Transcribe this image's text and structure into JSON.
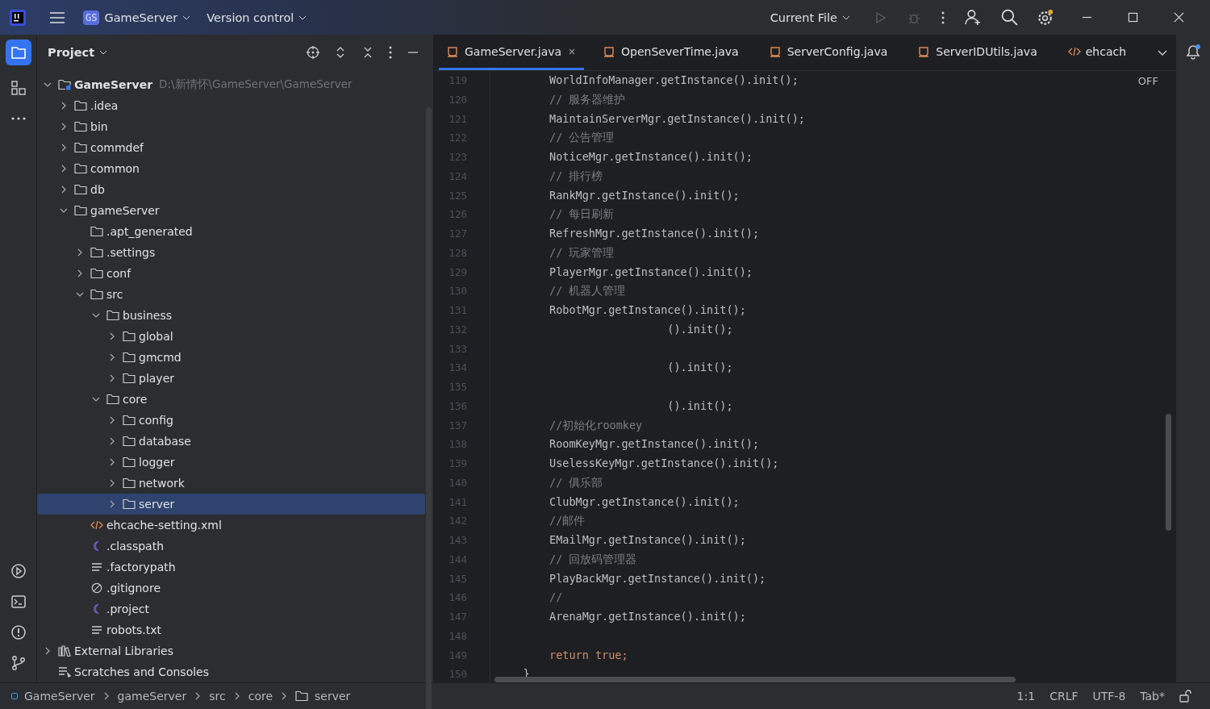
{
  "title_bar": {
    "project_badge": "GS",
    "project": "GameServer",
    "vcs": "Version control",
    "run_config": "Current File"
  },
  "project_panel": {
    "title": "Project",
    "tree": [
      {
        "label": "GameServer",
        "path": "D:\\新情怀\\GameServer\\GameServer",
        "kind": "module",
        "expanded": true,
        "selected": false,
        "children": [
          {
            "label": ".idea",
            "kind": "folder",
            "expanded": false,
            "selected": false
          },
          {
            "label": "bin",
            "kind": "folder",
            "expanded": false,
            "selected": false
          },
          {
            "label": "commdef",
            "kind": "folder",
            "expanded": false,
            "selected": false
          },
          {
            "label": "common",
            "kind": "folder",
            "expanded": false,
            "selected": false
          },
          {
            "label": "db",
            "kind": "folder",
            "expanded": false,
            "selected": false
          },
          {
            "label": "gameServer",
            "kind": "folder",
            "expanded": true,
            "selected": false,
            "children": [
              {
                "label": ".apt_generated",
                "kind": "folder",
                "selected": false
              },
              {
                "label": ".settings",
                "kind": "folder",
                "expanded": false,
                "selected": false
              },
              {
                "label": "conf",
                "kind": "folder",
                "expanded": false,
                "selected": false
              },
              {
                "label": "src",
                "kind": "folder",
                "expanded": true,
                "selected": false,
                "children": [
                  {
                    "label": "business",
                    "kind": "folder",
                    "expanded": true,
                    "selected": false,
                    "children": [
                      {
                        "label": "global",
                        "kind": "folder",
                        "expanded": false,
                        "selected": false
                      },
                      {
                        "label": "gmcmd",
                        "kind": "folder",
                        "expanded": false,
                        "selected": false
                      },
                      {
                        "label": "player",
                        "kind": "folder",
                        "expanded": false,
                        "selected": false
                      }
                    ]
                  },
                  {
                    "label": "core",
                    "kind": "folder",
                    "expanded": true,
                    "selected": false,
                    "children": [
                      {
                        "label": "config",
                        "kind": "folder",
                        "expanded": false,
                        "selected": false
                      },
                      {
                        "label": "database",
                        "kind": "folder",
                        "expanded": false,
                        "selected": false
                      },
                      {
                        "label": "logger",
                        "kind": "folder",
                        "expanded": false,
                        "selected": false
                      },
                      {
                        "label": "network",
                        "kind": "folder",
                        "expanded": false,
                        "selected": false
                      },
                      {
                        "label": "server",
                        "kind": "folder",
                        "expanded": false,
                        "selected": true
                      }
                    ]
                  }
                ]
              },
              {
                "label": "ehcache-setting.xml",
                "kind": "xml",
                "selected": false
              },
              {
                "label": ".classpath",
                "kind": "eclipse",
                "selected": false
              },
              {
                "label": ".factorypath",
                "kind": "text",
                "selected": false
              },
              {
                "label": ".gitignore",
                "kind": "ignore",
                "selected": false
              },
              {
                "label": ".project",
                "kind": "eclipse",
                "selected": false
              },
              {
                "label": "robots.txt",
                "kind": "text",
                "selected": false
              }
            ]
          }
        ]
      },
      {
        "label": "External Libraries",
        "kind": "libraries",
        "expanded": false,
        "selected": false
      },
      {
        "label": "Scratches and Consoles",
        "kind": "scratches",
        "selected": false
      }
    ]
  },
  "editor": {
    "tabs": [
      {
        "label": "GameServer.java",
        "kind": "java",
        "selected": true
      },
      {
        "label": "OpenSeverTime.java",
        "kind": "java",
        "selected": false
      },
      {
        "label": "ServerConfig.java",
        "kind": "java",
        "selected": false
      },
      {
        "label": "ServerIDUtils.java",
        "kind": "java",
        "selected": false
      },
      {
        "label": "ehcach",
        "kind": "xml",
        "selected": false
      }
    ],
    "inlay_status": "OFF",
    "lines": [
      {
        "number": "119",
        "kind": "code",
        "text": "        WorldInfoManager.getInstance().init();"
      },
      {
        "number": "120",
        "kind": "comment",
        "text": "        // 服务器维护"
      },
      {
        "number": "121",
        "kind": "code",
        "text": "        MaintainServerMgr.getInstance().init();"
      },
      {
        "number": "122",
        "kind": "comment",
        "text": "        // 公告管理"
      },
      {
        "number": "123",
        "kind": "code",
        "text": "        NoticeMgr.getInstance().init();"
      },
      {
        "number": "124",
        "kind": "comment",
        "text": "        // 排行榜"
      },
      {
        "number": "125",
        "kind": "code",
        "text": "        RankMgr.getInstance().init();"
      },
      {
        "number": "126",
        "kind": "comment",
        "text": "        // 每日刷新"
      },
      {
        "number": "127",
        "kind": "code",
        "text": "        RefreshMgr.getInstance().init();"
      },
      {
        "number": "128",
        "kind": "comment",
        "text": "        // 玩家管理"
      },
      {
        "number": "129",
        "kind": "code",
        "text": "        PlayerMgr.getInstance().init();"
      },
      {
        "number": "130",
        "kind": "comment",
        "text": "        // 机器人管理"
      },
      {
        "number": "131",
        "kind": "code",
        "text": "        RobotMgr.getInstance().init();"
      },
      {
        "number": "132",
        "kind": "code",
        "text": "                          ().init();"
      },
      {
        "number": "133"
      },
      {
        "number": "134",
        "kind": "code",
        "text": "                          ().init();"
      },
      {
        "number": "135"
      },
      {
        "number": "136",
        "kind": "code",
        "text": "                          ().init();"
      },
      {
        "number": "137",
        "kind": "comment",
        "text": "        //初始化roomkey"
      },
      {
        "number": "138",
        "kind": "code",
        "text": "        RoomKeyMgr.getInstance().init();"
      },
      {
        "number": "139",
        "kind": "code",
        "text": "        UselessKeyMgr.getInstance().init();"
      },
      {
        "number": "140",
        "kind": "comment",
        "text": "        // 俱乐部"
      },
      {
        "number": "141",
        "kind": "code",
        "text": "        ClubMgr.getInstance().init();"
      },
      {
        "number": "142",
        "kind": "comment",
        "text": "        //邮件"
      },
      {
        "number": "143",
        "kind": "code",
        "text": "        EMailMgr.getInstance().init();"
      },
      {
        "number": "144",
        "kind": "comment",
        "text": "        // 回放码管理器"
      },
      {
        "number": "145",
        "kind": "code",
        "text": "        PlayBackMgr.getInstance().init();"
      },
      {
        "number": "146",
        "kind": "comment",
        "text": "        //"
      },
      {
        "number": "147",
        "kind": "code",
        "text": "        ArenaMgr.getInstance().init();"
      },
      {
        "number": "148"
      },
      {
        "number": "149",
        "kind": "keyword",
        "text": "        return true;"
      },
      {
        "number": "150",
        "kind": "code",
        "text": "    }"
      }
    ]
  },
  "status_bar": {
    "breadcrumbs": [
      "GameServer",
      "gameServer",
      "src",
      "core",
      "server"
    ],
    "position": "1:1",
    "line_separator": "CRLF",
    "encoding": "UTF-8",
    "indent": "Tab*"
  }
}
